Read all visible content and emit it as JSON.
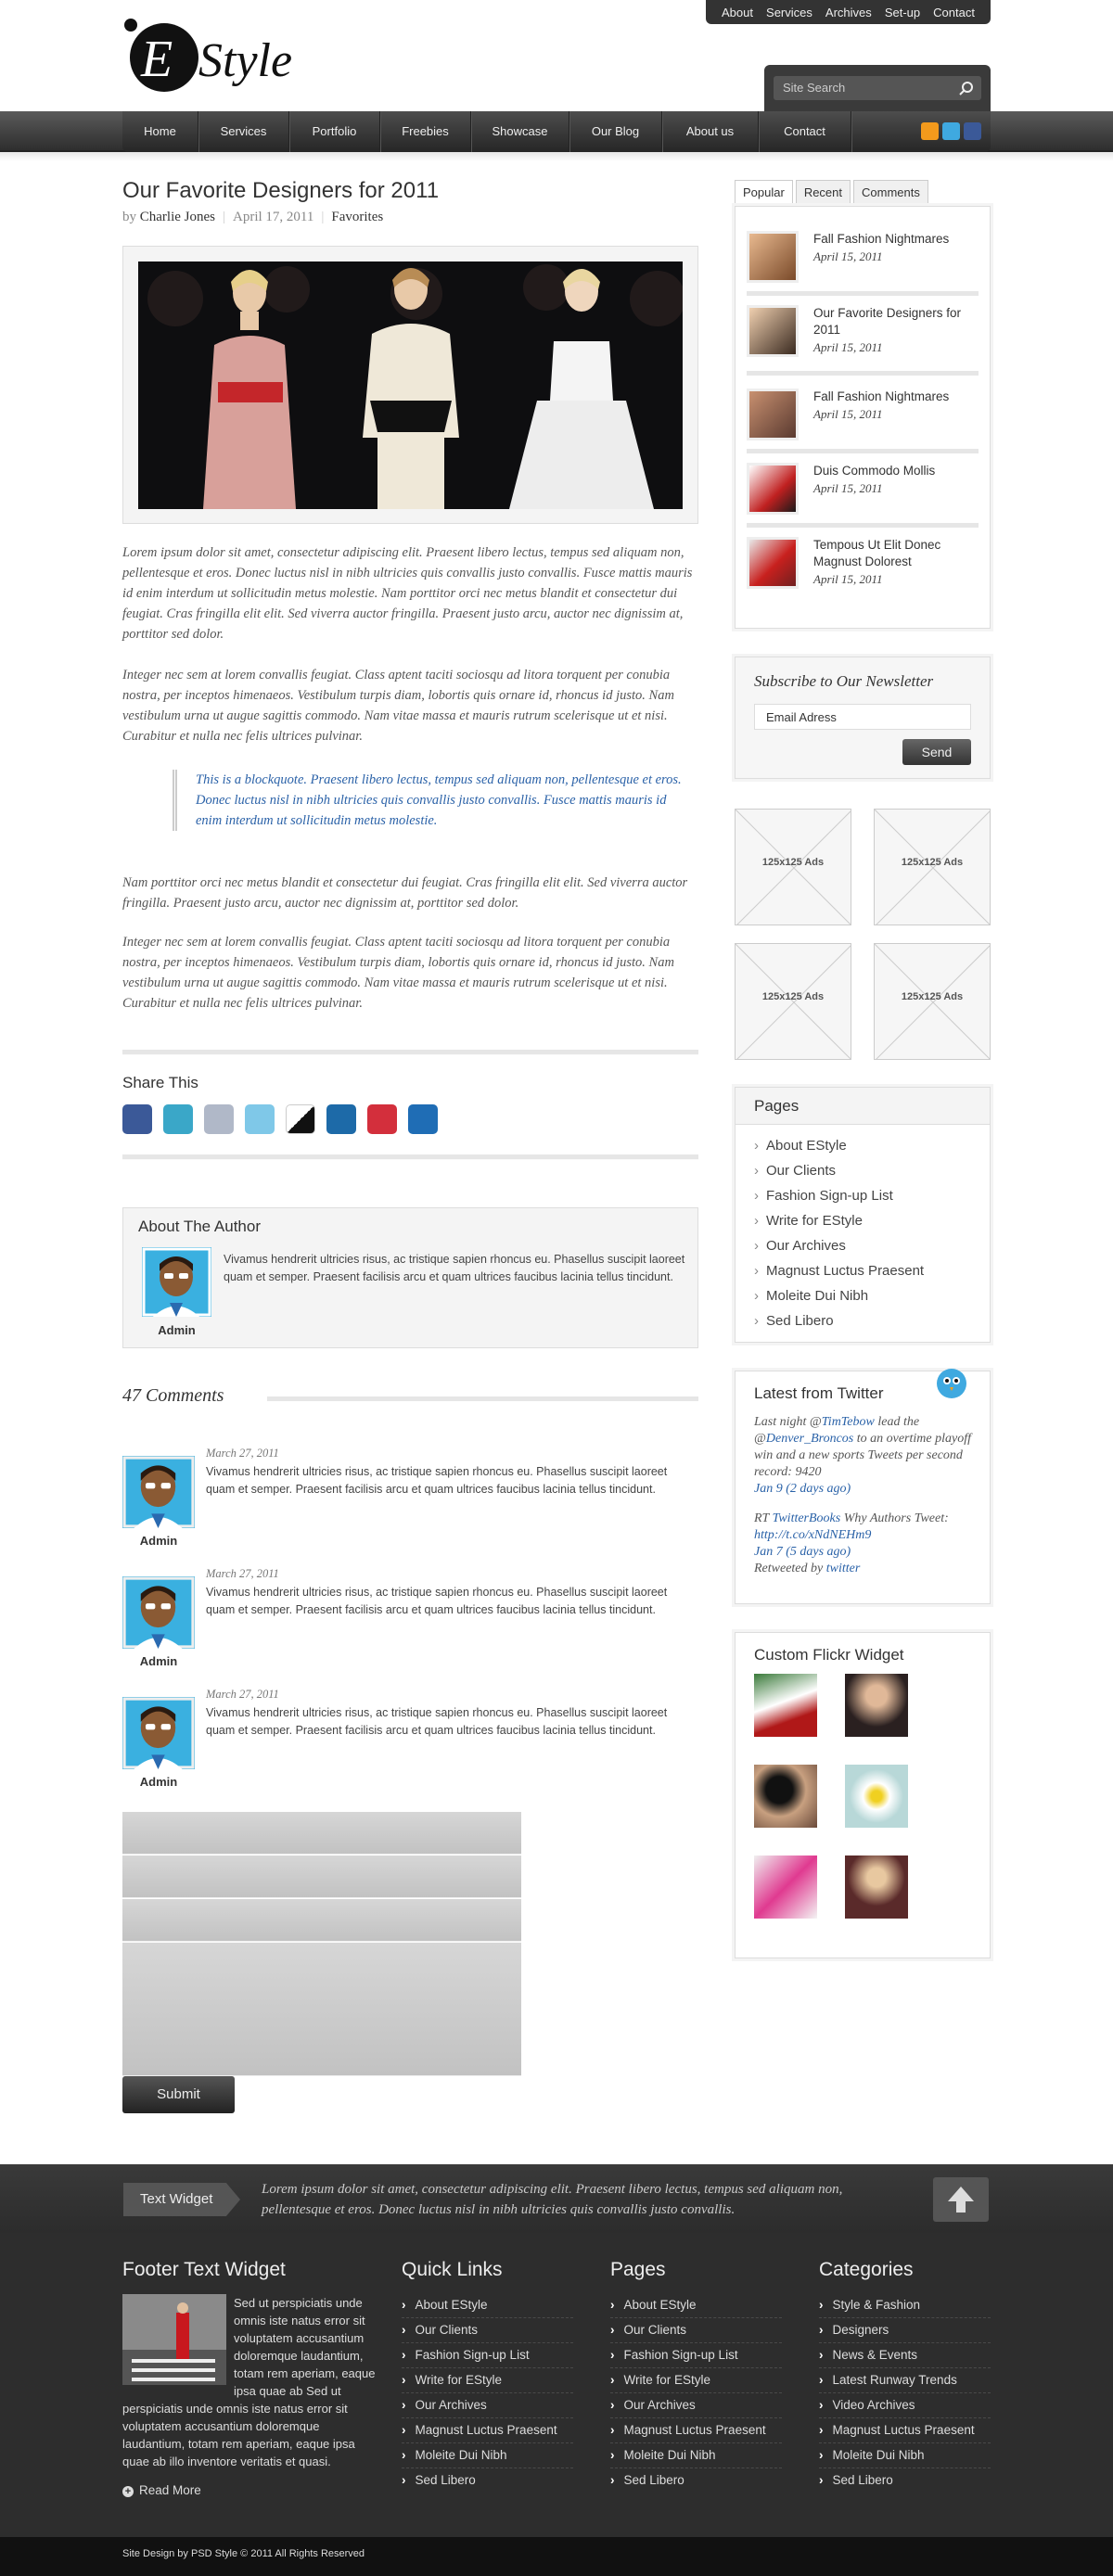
{
  "topnav": [
    "About",
    "Services",
    "Archives",
    "Set-up",
    "Contact"
  ],
  "search": {
    "placeholder": "Site Search"
  },
  "nav": [
    "Home",
    "Services",
    "Portfolio",
    "Freebies",
    "Showcase",
    "Our Blog",
    "About us",
    "Contact"
  ],
  "post": {
    "title": "Our Favorite Designers for 2011",
    "by": "by",
    "author": "Charlie Jones",
    "date": "April 17, 2011",
    "category": "Favorites",
    "p1": "Lorem ipsum dolor sit amet, consectetur adipiscing elit. Praesent libero lectus, tempus sed aliquam non, pellentesque et eros. Donec luctus nisl in nibh ultricies quis convallis justo convallis. Fusce mattis mauris id enim interdum ut sollicitudin metus molestie. Nam porttitor orci nec metus blandit et consectetur dui feugiat. Cras fringilla elit elit. Sed viverra auctor fringilla. Praesent justo arcu, auctor nec dignissim at, porttitor sed dolor.",
    "p2": "Integer nec sem at lorem convallis feugiat. Class aptent taciti sociosqu ad litora torquent per conubia nostra, per inceptos himenaeos. Vestibulum turpis diam, lobortis quis ornare id, rhoncus id justo. Nam vestibulum urna ut augue sagittis commodo. Nam vitae massa et mauris rutrum scelerisque ut et nisi. Curabitur et nulla nec felis ultrices pulvinar.",
    "quote": "This is a blockquote. Praesent libero lectus, tempus sed aliquam non, pellentesque et eros. Donec luctus nisl in nibh ultricies quis convallis justo convallis. Fusce mattis mauris id enim interdum ut sollicitudin metus molestie.",
    "p3": "Nam porttitor orci nec metus blandit et consectetur dui feugiat. Cras fringilla elit elit. Sed viverra auctor fringilla. Praesent justo arcu, auctor nec dignissim at, porttitor sed dolor.",
    "p4": "Integer nec sem at lorem convallis feugiat. Class aptent taciti sociosqu ad litora torquent per conubia nostra, per inceptos himenaeos. Vestibulum turpis diam, lobortis quis ornare id, rhoncus id justo. Nam vestibulum urna ut augue sagittis commodo. Nam vitae massa et mauris rutrum scelerisque ut et nisi. Curabitur et nulla nec felis ultrices pulvinar."
  },
  "share": {
    "title": "Share This",
    "icons": [
      "facebook-icon",
      "stumbleupon-icon",
      "google-icon",
      "twitter-icon",
      "delicious-icon",
      "digg-icon",
      "myspace-icon",
      "linkedin-icon"
    ]
  },
  "author": {
    "title": "About The Author",
    "name": "Admin",
    "bio": "Vivamus hendrerit ultricies risus, ac tristique sapien rhoncus eu. Phasellus suscipit laoreet quam et semper. Praesent facilisis arcu et quam ultrices faucibus lacinia tellus tincidunt."
  },
  "comments": {
    "count": "47 Comments",
    "items": [
      {
        "date": "March 27, 2011",
        "name": "Admin",
        "text": "Vivamus hendrerit ultricies risus, ac tristique sapien rhoncus eu. Phasellus suscipit laoreet quam et semper. Praesent facilisis arcu et quam ultrices faucibus lacinia tellus tincidunt."
      },
      {
        "date": "March 27, 2011",
        "name": "Admin",
        "text": "Vivamus hendrerit ultricies risus, ac tristique sapien rhoncus eu. Phasellus suscipit laoreet quam et semper. Praesent facilisis arcu et quam ultrices faucibus lacinia tellus tincidunt."
      },
      {
        "date": "March 27, 2011",
        "name": "Admin",
        "text": "Vivamus hendrerit ultricies risus, ac tristique sapien rhoncus eu. Phasellus suscipit laoreet quam et semper. Praesent facilisis arcu et quam ultrices faucibus lacinia tellus tincidunt."
      }
    ],
    "submit": "Submit"
  },
  "sidebar": {
    "tabs": [
      "Popular",
      "Recent",
      "Comments"
    ],
    "popular": [
      {
        "title": "Fall Fashion Nightmares",
        "date": "April 15, 2011"
      },
      {
        "title": "Our Favorite Designers for 2011",
        "date": "April 15, 2011"
      },
      {
        "title": "Fall Fashion Nightmares",
        "date": "April 15, 2011"
      },
      {
        "title": "Duis Commodo Mollis",
        "date": "April 15, 2011"
      },
      {
        "title": "Tempous Ut Elit Donec Magnust Dolorest",
        "date": "April 15, 2011"
      }
    ],
    "newsletter": {
      "title": "Subscribe to Our Newsletter",
      "email": "Email Adress",
      "send": "Send"
    },
    "ads": [
      "125x125 Ads",
      "125x125 Ads",
      "125x125 Ads",
      "125x125 Ads"
    ],
    "pages": {
      "title": "Pages",
      "items": [
        "About EStyle",
        "Our Clients",
        "Fashion Sign-up List",
        "Write for EStyle",
        "Our Archives",
        "Magnust Luctus Praesent",
        "Moleite Dui Nibh",
        "Sed Libero"
      ]
    },
    "twitter": {
      "title": "Latest from Twitter",
      "t1a": "Last night @",
      "t1user": "TimTebow",
      "t1b": " lead the @",
      "t1user2": "Denver_Broncos",
      "t1c": " to an overtime playoff win and a new sports Tweets per second record: 9420",
      "t1date": "Jan 9 (2 days ago)",
      "t2a": "RT ",
      "t2user": "TwitterBooks",
      "t2b": " Why Authors Tweet: ",
      "t2link": "http://t.co/xNdNEHm9",
      "t2date": "Jan 7 (5 days ago)",
      "t2via": "Retweeted by ",
      "t2viauser": "twitter"
    },
    "flickr": {
      "title": "Custom Flickr Widget"
    }
  },
  "footerbar": {
    "badge": "Text Widget",
    "text": "Lorem ipsum dolor sit amet, consectetur adipiscing elit. Praesent libero lectus, tempus sed aliquam non, pellentesque et eros. Donec luctus nisl in nibh ultricies quis convallis justo convallis."
  },
  "footer": {
    "textwidget": {
      "title": "Footer Text Widget",
      "text": "Sed ut perspiciatis unde omnis iste natus error sit voluptatem accusantium doloremque laudantium, totam rem aperiam, eaque ipsa quae ab Sed ut perspiciatis unde omnis iste natus error sit voluptatem accusantium doloremque laudantium, totam rem aperiam, eaque ipsa quae ab illo inventore veritatis et quasi.",
      "more": "Read More"
    },
    "quicklinks": {
      "title": "Quick Links",
      "items": [
        "About EStyle",
        "Our Clients",
        "Fashion Sign-up List",
        "Write for EStyle",
        "Our Archives",
        "Magnust Luctus Praesent",
        "Moleite Dui Nibh",
        "Sed Libero"
      ]
    },
    "pages": {
      "title": "Pages",
      "items": [
        "About EStyle",
        "Our Clients",
        "Fashion Sign-up List",
        "Write for EStyle",
        "Our Archives",
        "Magnust Luctus Praesent",
        "Moleite Dui Nibh",
        "Sed Libero"
      ]
    },
    "categories": {
      "title": "Categories",
      "items": [
        "Style & Fashion",
        "Designers",
        "News & Events",
        "Latest Runway Trends",
        "Video Archives",
        "Magnust Luctus Praesent",
        "Moleite Dui Nibh",
        "Sed Libero"
      ]
    }
  },
  "copyright": "Site Design by PSD Style © 2011 All Rights Reserved"
}
